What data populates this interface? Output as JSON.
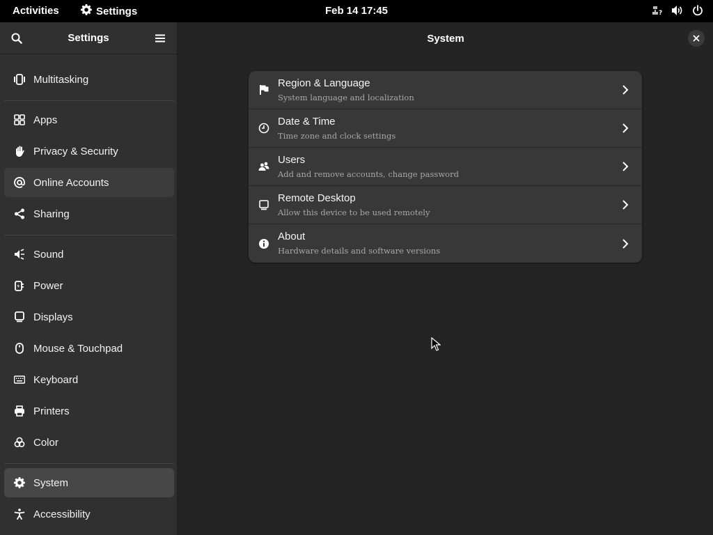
{
  "topbar": {
    "activities": "Activities",
    "app_name": "Settings",
    "clock": "Feb 14  17:45"
  },
  "sidebar": {
    "title": "Settings",
    "items": [
      {
        "label": "Multitasking",
        "icon": "multitasking-icon"
      },
      {
        "label": "Apps",
        "icon": "apps-icon"
      },
      {
        "label": "Privacy & Security",
        "icon": "hand-icon"
      },
      {
        "label": "Online Accounts",
        "icon": "at-icon"
      },
      {
        "label": "Sharing",
        "icon": "share-icon"
      },
      {
        "label": "Sound",
        "icon": "speaker-icon"
      },
      {
        "label": "Power",
        "icon": "power-plug-icon"
      },
      {
        "label": "Displays",
        "icon": "display-icon"
      },
      {
        "label": "Mouse & Touchpad",
        "icon": "mouse-icon"
      },
      {
        "label": "Keyboard",
        "icon": "keyboard-icon"
      },
      {
        "label": "Printers",
        "icon": "printer-icon"
      },
      {
        "label": "Color",
        "icon": "color-icon"
      },
      {
        "label": "System",
        "icon": "gear-icon"
      },
      {
        "label": "Accessibility",
        "icon": "accessibility-icon"
      }
    ],
    "selected": "System",
    "hovered": "Online Accounts"
  },
  "main": {
    "title": "System",
    "rows": [
      {
        "title": "Region & Language",
        "subtitle": "System language and localization",
        "icon": "flag-icon"
      },
      {
        "title": "Date & Time",
        "subtitle": "Time zone and clock settings",
        "icon": "clock-icon"
      },
      {
        "title": "Users",
        "subtitle": "Add and remove accounts, change password",
        "icon": "users-icon"
      },
      {
        "title": "Remote Desktop",
        "subtitle": "Allow this device to be used remotely",
        "icon": "remote-desktop-icon"
      },
      {
        "title": "About",
        "subtitle": "Hardware details and software versions",
        "icon": "info-icon"
      }
    ]
  },
  "colors": {
    "topbar_bg": "#000000",
    "sidebar_bg": "#303030",
    "content_bg": "#242424",
    "selected_item_bg": "#474747",
    "card_bg": "#383838"
  }
}
